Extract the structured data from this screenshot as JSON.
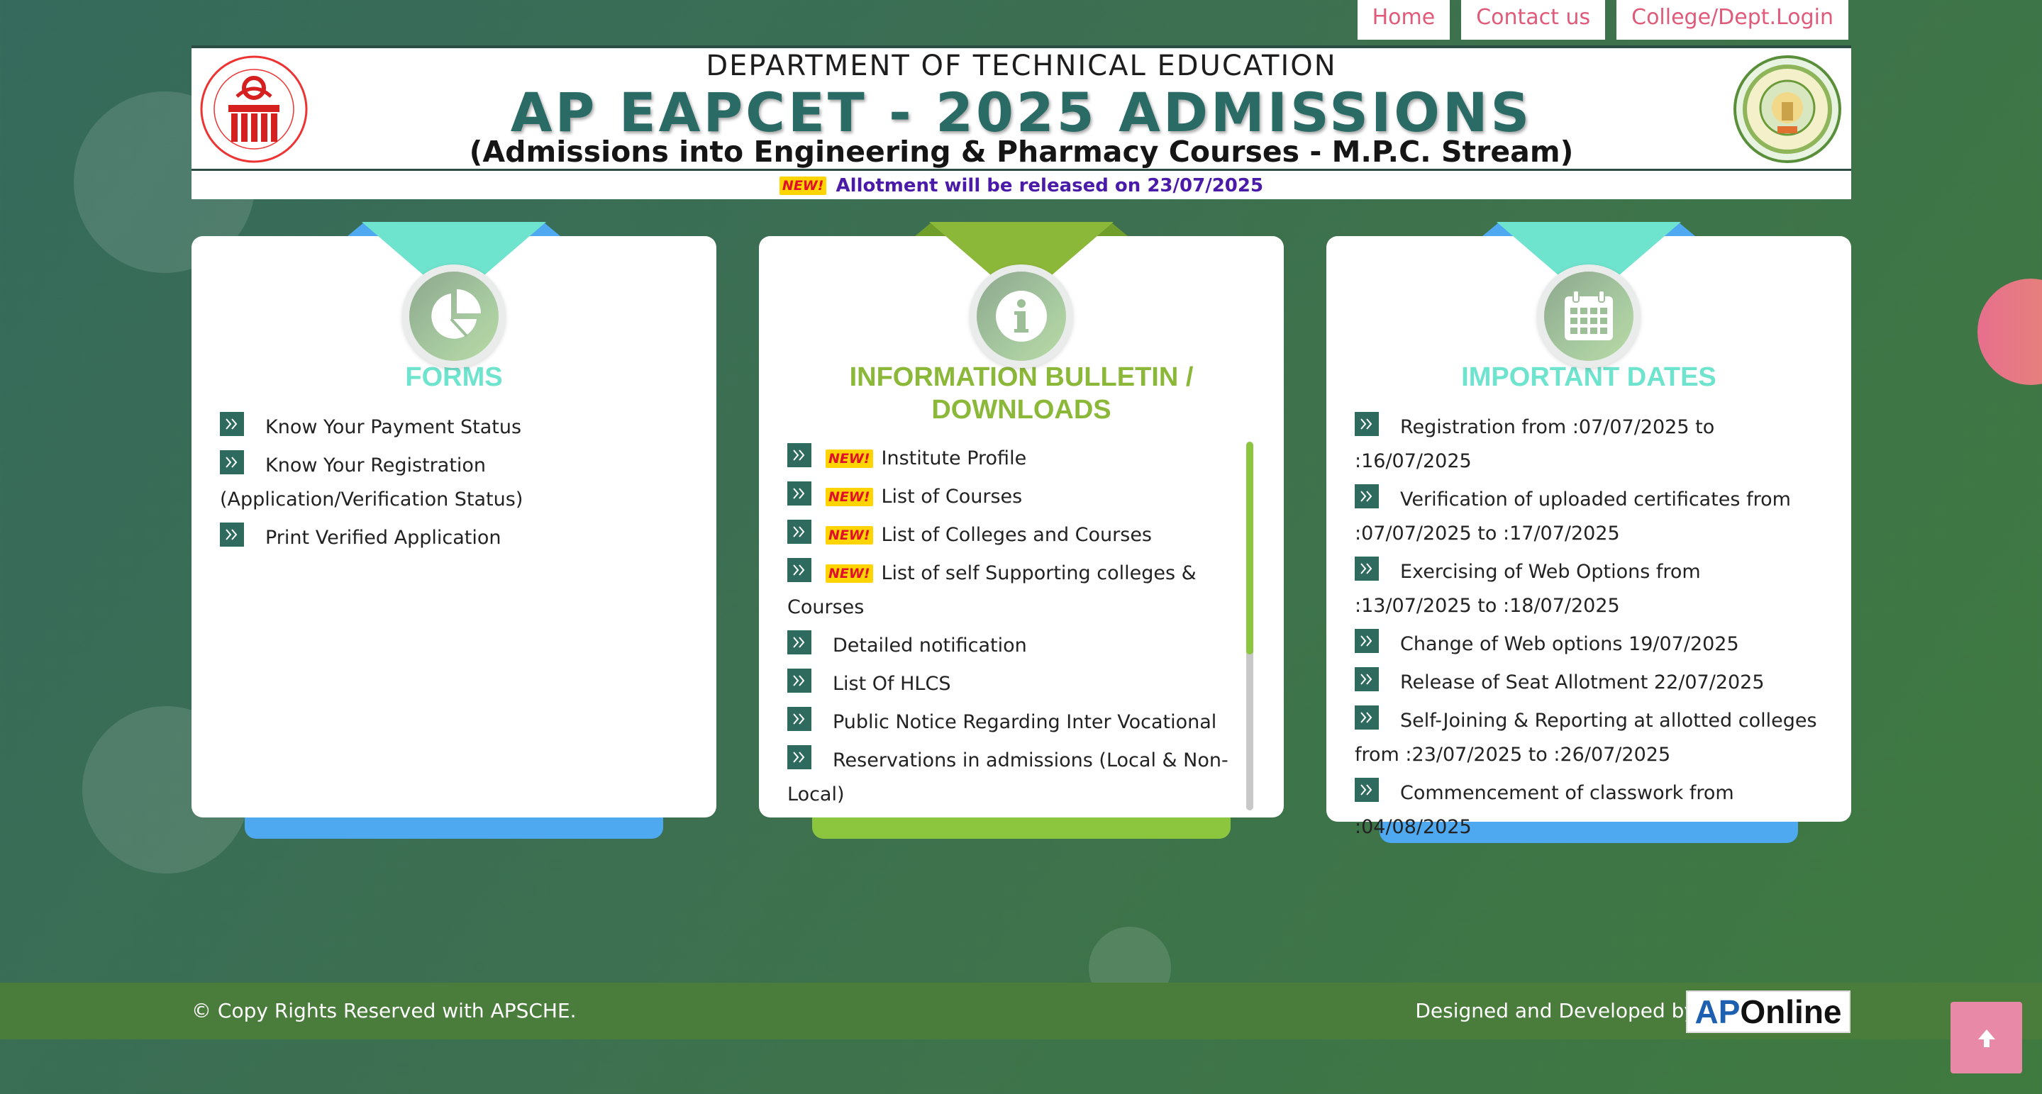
{
  "nav": {
    "links": [
      {
        "label": "Home"
      },
      {
        "label": "Contact us"
      },
      {
        "label": "College/Dept.Login"
      }
    ]
  },
  "header": {
    "left_logo_icon": "apsche-emblem-icon",
    "right_logo_icon": "ap-state-emblem-icon",
    "department": "DEPARTMENT OF TECHNICAL EDUCATION",
    "title": "AP EAPCET - 2025 ADMISSIONS",
    "subtitle": "(Admissions into Engineering & Pharmacy Courses - M.P.C. Stream)"
  },
  "ticker": {
    "badge": "NEW!",
    "text": "Allotment will be released on 23/07/2025"
  },
  "cards": {
    "forms": {
      "title": "FORMS",
      "icon": "pie-chart-icon",
      "accent": "#6ee3cd",
      "foot_color": "#4ea9f0",
      "items": [
        {
          "label": "Know Your Payment Status"
        },
        {
          "label": "Know Your Registration (Application/Verification Status)"
        },
        {
          "label": "Print Verified Application"
        }
      ]
    },
    "bulletin": {
      "title": "INFORMATION BULLETIN / DOWNLOADS",
      "icon": "info-icon",
      "accent": "#8cb83a",
      "foot_color": "#8cc63f",
      "items": [
        {
          "label": "Institute Profile",
          "badge": "NEW!"
        },
        {
          "label": "List of Courses",
          "badge": "NEW!"
        },
        {
          "label": "List of Colleges and Courses",
          "badge": "NEW!"
        },
        {
          "label": "List of self Supporting colleges & Courses",
          "badge": "NEW!"
        },
        {
          "label": "Detailed notification"
        },
        {
          "label": "List Of HLCS"
        },
        {
          "label": "Public Notice Regarding Inter Vocational"
        },
        {
          "label": "Reservations in admissions (Local & Non-Local)"
        }
      ]
    },
    "dates": {
      "title": "IMPORTANT DATES",
      "icon": "calendar-icon",
      "accent": "#6ee3cd",
      "foot_color": "#4ea9f0",
      "items": [
        {
          "label": "Registration from :07/07/2025 to :16/07/2025"
        },
        {
          "label": "Verification of uploaded certificates from :07/07/2025 to :17/07/2025"
        },
        {
          "label": "Exercising of Web Options from :13/07/2025 to :18/07/2025"
        },
        {
          "label": "Change of Web options 19/07/2025"
        },
        {
          "label": "Release of Seat Allotment 22/07/2025"
        },
        {
          "label": "Self-Joining & Reporting at allotted colleges from :23/07/2025 to :26/07/2025"
        },
        {
          "label": "Commencement of classwork from :04/08/2025"
        }
      ]
    }
  },
  "footer": {
    "copyright": "© Copy Rights Reserved with APSCHE.",
    "designed_by": "Designed and Developed by",
    "brand_ap": "AP",
    "brand_online": "Online"
  },
  "scroll_top": {
    "icon": "arrow-up-icon"
  }
}
